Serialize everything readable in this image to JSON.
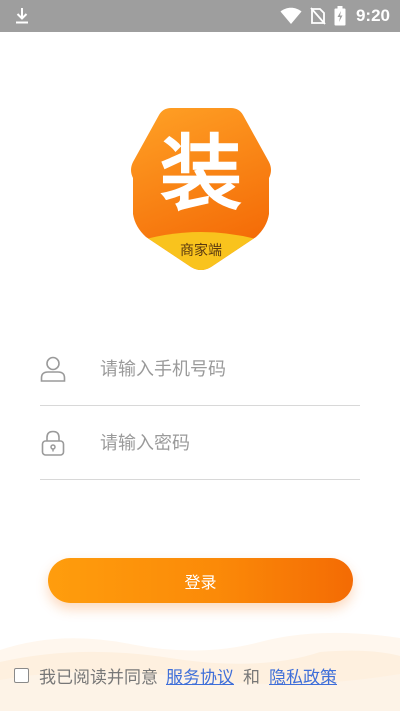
{
  "status_bar": {
    "time": "9:20",
    "icons": [
      "download-icon",
      "wifi-icon",
      "no-sim-icon",
      "battery-charging-icon"
    ]
  },
  "logo": {
    "main_char": "装",
    "subtitle": "商家端",
    "colors": {
      "orange_top": "#ff9a1e",
      "orange_bottom": "#f46b07",
      "band_yellow": "#f9c31d"
    }
  },
  "form": {
    "phone_placeholder": "请输入手机号码",
    "phone_value": "",
    "password_placeholder": "请输入密码",
    "password_value": ""
  },
  "login_button": {
    "label": "登录"
  },
  "agreement": {
    "checked": false,
    "prefix": "我已阅读并同意",
    "service_link": "服务协议",
    "conjunction": "和",
    "privacy_link": "隐私政策"
  },
  "colors": {
    "accent": "#fb8a08",
    "link": "#3f6fd9",
    "status_bar": "#9e9e9e"
  }
}
